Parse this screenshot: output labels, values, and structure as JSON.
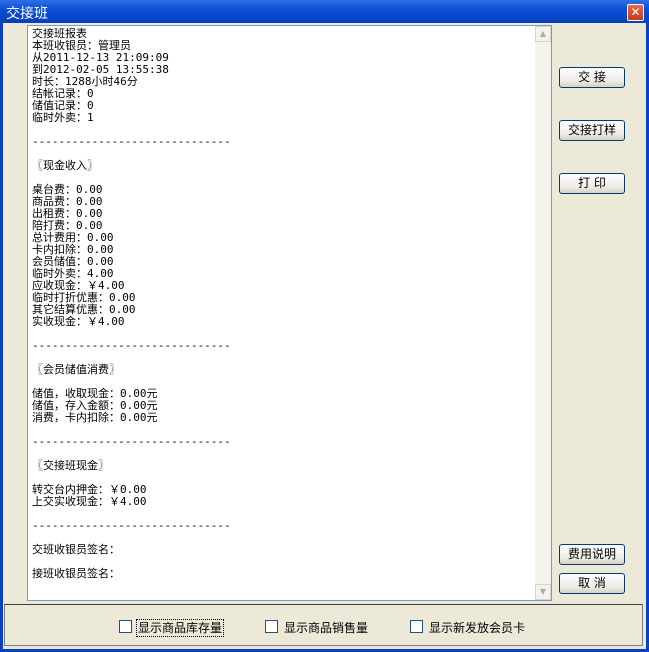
{
  "window": {
    "title": "交接班",
    "close_label": "✕"
  },
  "report": {
    "lines": [
      "交接班报表",
      "本班收银员：管理员",
      "从2011-12-13 21:09:09",
      "到2012-02-05 13:55:38",
      "时长：1288小时46分",
      "结帐记录：0",
      "储值记录：0",
      "临时外卖：1",
      "",
      "------------------------------",
      "",
      "〖现金收入〗",
      "",
      "桌台费：0.00",
      "商品费：0.00",
      "出租费：0.00",
      "陪打费：0.00",
      "总计费用：0.00",
      "卡内扣除：0.00",
      "会员储值：0.00",
      "临时外卖：4.00",
      "应收现金：￥4.00",
      "临时打折优惠：0.00",
      "其它结算优惠：0.00",
      "实收现金：￥4.00",
      "",
      "------------------------------",
      "",
      "〖会员储值消费〗",
      "",
      "储值，收取现金：0.00元",
      "储值，存入金额：0.00元",
      "消费，卡内扣除：0.00元",
      "",
      "------------------------------",
      "",
      "〖交接班现金〗",
      "",
      "转交台内押金：￥0.00",
      "上交实收现金：￥4.00",
      "",
      "------------------------------",
      "",
      "交班收银员签名：",
      "",
      "接班收银员签名："
    ]
  },
  "buttons": {
    "handover": "交  接",
    "handover_print": "交接打样",
    "print": "打  印",
    "fee_explain": "费用说明",
    "cancel": "取  消"
  },
  "options": {
    "show_stock": "显示商品库存量",
    "show_sales": "显示商品销售量",
    "show_new_cards": "显示新发放会员卡"
  }
}
